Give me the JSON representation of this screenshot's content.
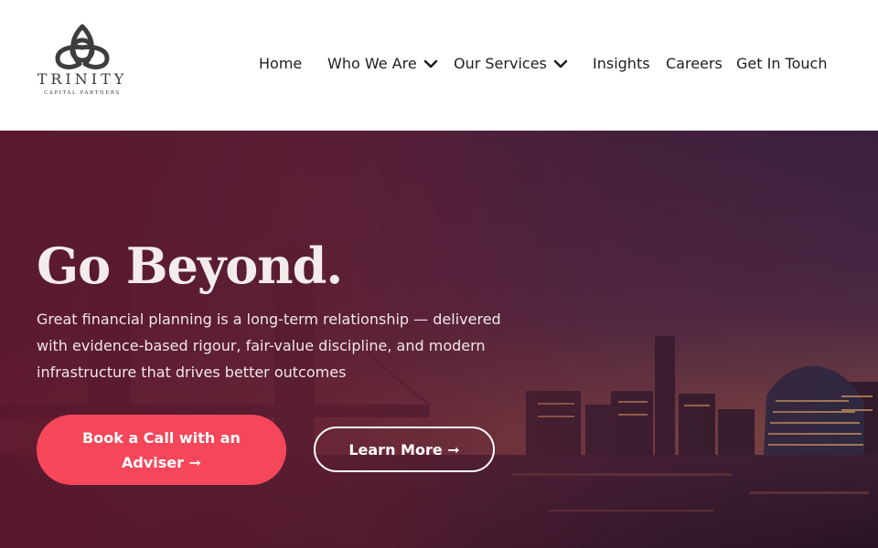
{
  "brand": {
    "name": "TRINITY",
    "tagline": "CAPITAL PARTNERS",
    "logo_icon": "trinity-knot-icon"
  },
  "nav": {
    "items": [
      {
        "label": "Home",
        "has_dropdown": false
      },
      {
        "label": "Who We Are",
        "has_dropdown": true,
        "icon": "chevron-down-icon"
      },
      {
        "label": "Our Services",
        "has_dropdown": true,
        "icon": "chevron-down-icon"
      },
      {
        "label": "Insights",
        "has_dropdown": false
      },
      {
        "label": "Careers",
        "has_dropdown": false
      },
      {
        "label": "Get In Touch",
        "has_dropdown": false
      }
    ]
  },
  "hero": {
    "title": "Go Beyond.",
    "text": "Great financial planning is a long-term relationship — delivered with evidence-based rigour, fair-value discipline, and modern infrastructure that drives better outcomes",
    "primary_button": "Book a Call with an Adviser ➞",
    "secondary_button": "Learn More ➞"
  },
  "colors": {
    "accent": "#f6475a",
    "hero_overlay": "#5c182e",
    "nav_text": "#1e1e1e"
  }
}
